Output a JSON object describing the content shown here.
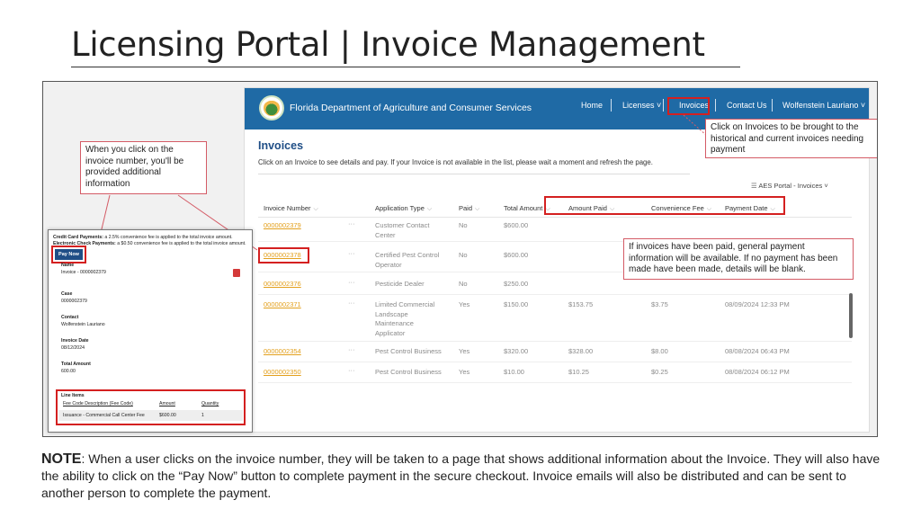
{
  "slide": {
    "title": "Licensing Portal | Invoice Management"
  },
  "portal": {
    "brand": "Florida Department of Agriculture and Consumer Services",
    "nav": {
      "home": "Home",
      "licenses": "Licenses ˅",
      "invoices": "Invoices",
      "contact": "Contact Us",
      "user": "Wolfenstein Lauriano ˅"
    },
    "heading": "Invoices",
    "description": "Click on an Invoice to see details and pay. If your Invoice is not available in the list, please wait a moment and refresh the page.",
    "view_selector": "AES Portal - Invoices ˅",
    "columns": [
      "Invoice Number",
      "Application Type",
      "Paid",
      "Total Amount",
      "Amount Paid",
      "Convenience Fee",
      "Payment Date"
    ],
    "rows": [
      {
        "invoice": "0000002379",
        "type": [
          "Customer Contact",
          "Center"
        ],
        "paid": "No",
        "total": "$600.00",
        "amount_paid": "",
        "fee": "",
        "date": ""
      },
      {
        "invoice": "0000002378",
        "type": [
          "Certified Pest Control",
          "Operator"
        ],
        "paid": "No",
        "total": "$600.00",
        "amount_paid": "",
        "fee": "",
        "date": ""
      },
      {
        "invoice": "0000002376",
        "type": [
          "Pesticide Dealer"
        ],
        "paid": "No",
        "total": "$250.00",
        "amount_paid": "",
        "fee": "",
        "date": ""
      },
      {
        "invoice": "0000002371",
        "type": [
          "Limited Commercial",
          "Landscape",
          "Maintenance",
          "Applicator"
        ],
        "paid": "Yes",
        "total": "$150.00",
        "amount_paid": "$153.75",
        "fee": "$3.75",
        "date": "08/09/2024 12:33 PM"
      },
      {
        "invoice": "0000002354",
        "type": [
          "Pest Control Business"
        ],
        "paid": "Yes",
        "total": "$320.00",
        "amount_paid": "$328.00",
        "fee": "$8.00",
        "date": "08/08/2024 06:43 PM"
      },
      {
        "invoice": "0000002350",
        "type": [
          "Pest Control Business"
        ],
        "paid": "Yes",
        "total": "$10.00",
        "amount_paid": "$10.25",
        "fee": "$0.25",
        "date": "08/08/2024 06:12 PM"
      }
    ]
  },
  "callouts": {
    "invoice_number": "When you click on the invoice number, you'll be provided additional information",
    "invoices_nav": "Click on Invoices to be brought to the historical and current invoices needing payment",
    "payment_info": "If invoices have been paid, general payment information will be available.  If no payment has been made have been made, details will be blank."
  },
  "detail_panel": {
    "cc_label": "Credit Card Payments:",
    "cc_text": "a 2.5% convenience fee is applied to the total invoice amount.",
    "echeck_label": "Electronic Check Payments:",
    "echeck_text": "a $0.50 convenience fee is applied to the total invoice amount.",
    "pay_now": "Pay Now",
    "name_label": "Name",
    "name_value": "Invoice - 0000002379",
    "case_label": "Case",
    "case_value": "0000002379",
    "contact_label": "Contact",
    "contact_value": "Wolfenstein Lauriano",
    "date_label": "Invoice Date",
    "date_value": "08/12/2024",
    "total_label": "Total Amount",
    "total_value": "600.00",
    "line_items_label": "Line Items",
    "li_col_desc": "Fee Code Description (Fee Code)",
    "li_col_amount": "Amount",
    "li_col_qty": "Quantity",
    "li_desc": "Issuance - Commercial Call Center Fee",
    "li_amount": "$600.00",
    "li_qty": "1"
  },
  "note": {
    "label": "NOTE",
    "text": ": When a user clicks on the invoice number, they will be taken to a page that shows additional information about the Invoice.  They will also have the ability to click on the “Pay Now” button to complete payment in the secure checkout. Invoice emails will also be distributed and can be sent to another person to complete the payment."
  },
  "colors": {
    "header_blue": "#1f6aa5",
    "link_orange": "#e3a01d",
    "highlight_red": "#d42020",
    "heading_blue": "#1f4e86"
  }
}
